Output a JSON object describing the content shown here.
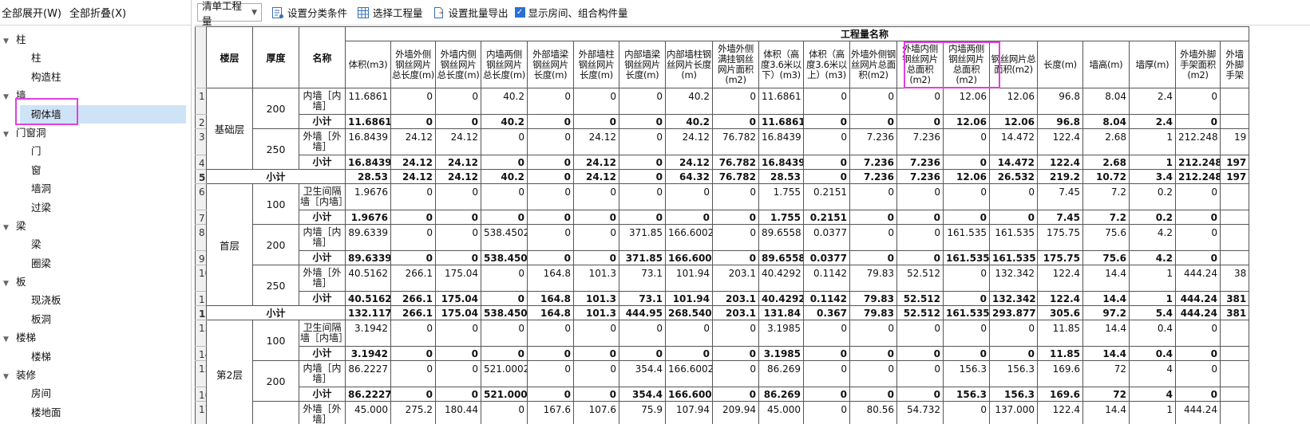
{
  "left_panel": {
    "expand_all": "全部展开(W)",
    "collapse_all": "全部折叠(X)",
    "tree": [
      {
        "label": "柱",
        "type": "cat"
      },
      {
        "label": "柱",
        "type": "leaf"
      },
      {
        "label": "构造柱",
        "type": "leaf"
      },
      {
        "label": "墙",
        "type": "cat"
      },
      {
        "label": "砌体墙",
        "type": "leaf",
        "selected": true
      },
      {
        "label": "门窗洞",
        "type": "cat"
      },
      {
        "label": "门",
        "type": "leaf"
      },
      {
        "label": "窗",
        "type": "leaf"
      },
      {
        "label": "墙洞",
        "type": "leaf"
      },
      {
        "label": "过梁",
        "type": "leaf"
      },
      {
        "label": "梁",
        "type": "cat"
      },
      {
        "label": "梁",
        "type": "leaf"
      },
      {
        "label": "圈梁",
        "type": "leaf"
      },
      {
        "label": "板",
        "type": "cat"
      },
      {
        "label": "现浇板",
        "type": "leaf"
      },
      {
        "label": "板洞",
        "type": "leaf"
      },
      {
        "label": "楼梯",
        "type": "cat"
      },
      {
        "label": "楼梯",
        "type": "leaf"
      },
      {
        "label": "装修",
        "type": "cat"
      },
      {
        "label": "房间",
        "type": "leaf"
      },
      {
        "label": "楼地面",
        "type": "leaf"
      }
    ]
  },
  "toolbar": {
    "qty_type": "清单工程量",
    "set_category": "设置分类条件",
    "select_qty": "选择工程量",
    "set_batch_export": "设置批量导出",
    "show_room": "显示房间、组合构件量",
    "show_room_checked": true
  },
  "table": {
    "group_header": "工程量名称",
    "col_floor": "楼层",
    "col_thickness": "厚度",
    "col_name": "名称",
    "qty_columns": [
      "体积(m3)",
      "外墙外侧钢丝网片总长度(m)",
      "外墙内侧钢丝网片总长度(m)",
      "内墙两侧钢丝网片总长度(m)",
      "外部墙梁钢丝网片长度(m)",
      "外部墙柱钢丝网片长度(m)",
      "内部墙梁钢丝网片长度(m)",
      "内部墙柱钢丝网片长度(m)",
      "外墙外侧满挂钢丝网片面积(m2)",
      "体积（高度3.6米以下）(m3)",
      "体积（高度3.6米以上）(m3)",
      "外墙外侧钢丝网片总面积(m2)",
      "外墙内侧钢丝网片总面积(m2)",
      "内墙两侧钢丝网片总面积(m2)",
      "钢丝网片总面积(m2)",
      "长度(m)",
      "墙高(m)",
      "墙厚(m)",
      "外墙外脚手架面积(m2)",
      "外墙外脚手架"
    ],
    "rows": [
      {
        "n": "1",
        "kind": "item",
        "name": "内墙［内墙］",
        "v": [
          "11.6861",
          "0",
          "0",
          "40.2",
          "0",
          "0",
          "0",
          "40.2",
          "0",
          "11.6861",
          "0",
          "0",
          "0",
          "12.06",
          "12.06",
          "96.8",
          "8.04",
          "2.4",
          "0",
          ""
        ]
      },
      {
        "n": "2",
        "kind": "sub",
        "name": "小计",
        "v": [
          "11.6861",
          "0",
          "0",
          "40.2",
          "0",
          "0",
          "0",
          "40.2",
          "0",
          "11.6861",
          "0",
          "0",
          "0",
          "12.06",
          "12.06",
          "96.8",
          "8.04",
          "2.4",
          "0",
          ""
        ]
      },
      {
        "n": "3",
        "kind": "item",
        "name": "外墙［外墙］",
        "v": [
          "16.8439",
          "24.12",
          "24.12",
          "0",
          "0",
          "24.12",
          "0",
          "24.12",
          "76.782",
          "16.8439",
          "0",
          "7.236",
          "7.236",
          "0",
          "14.472",
          "122.4",
          "2.68",
          "1",
          "212.248",
          "19"
        ]
      },
      {
        "n": "4",
        "kind": "sub",
        "name": "小计",
        "v": [
          "16.8439",
          "24.12",
          "24.12",
          "0",
          "0",
          "24.12",
          "0",
          "24.12",
          "76.782",
          "16.8439",
          "0",
          "7.236",
          "7.236",
          "0",
          "14.472",
          "122.4",
          "2.68",
          "1",
          "212.248",
          "197"
        ]
      },
      {
        "n": "5",
        "kind": "tot",
        "name": "小计",
        "v": [
          "28.53",
          "24.12",
          "24.12",
          "40.2",
          "0",
          "24.12",
          "0",
          "64.32",
          "76.782",
          "28.53",
          "0",
          "7.236",
          "7.236",
          "12.06",
          "26.532",
          "219.2",
          "10.72",
          "3.4",
          "212.248",
          "197"
        ]
      },
      {
        "n": "6",
        "kind": "item",
        "name": "卫生间隔墙［内墙］",
        "v": [
          "1.9676",
          "0",
          "0",
          "0",
          "0",
          "0",
          "0",
          "0",
          "0",
          "1.755",
          "0.2151",
          "0",
          "0",
          "0",
          "0",
          "7.45",
          "7.2",
          "0.2",
          "0",
          ""
        ]
      },
      {
        "n": "7",
        "kind": "sub",
        "name": "小计",
        "v": [
          "1.9676",
          "0",
          "0",
          "0",
          "0",
          "0",
          "0",
          "0",
          "0",
          "1.755",
          "0.2151",
          "0",
          "0",
          "0",
          "0",
          "7.45",
          "7.2",
          "0.2",
          "0",
          ""
        ]
      },
      {
        "n": "8",
        "kind": "item",
        "name": "内墙［内墙］",
        "v": [
          "89.6339",
          "0",
          "0",
          "538.4502",
          "0",
          "0",
          "371.85",
          "166.6002",
          "0",
          "89.6558",
          "0.0377",
          "0",
          "0",
          "161.535",
          "161.535",
          "175.75",
          "75.6",
          "4.2",
          "0",
          ""
        ]
      },
      {
        "n": "9",
        "kind": "sub",
        "name": "小计",
        "v": [
          "89.6339",
          "0",
          "0",
          "538.4502",
          "0",
          "0",
          "371.85",
          "166.6002",
          "0",
          "89.6558",
          "0.0377",
          "0",
          "0",
          "161.535",
          "161.535",
          "175.75",
          "75.6",
          "4.2",
          "0",
          ""
        ]
      },
      {
        "n": "10",
        "kind": "item",
        "name": "外墙［外墙］",
        "v": [
          "40.5162",
          "266.1",
          "175.04",
          "0",
          "164.8",
          "101.3",
          "73.1",
          "101.94",
          "203.1",
          "40.4292",
          "0.1142",
          "79.83",
          "52.512",
          "0",
          "132.342",
          "122.4",
          "14.4",
          "1",
          "444.24",
          "38"
        ]
      },
      {
        "n": "11",
        "kind": "sub",
        "name": "小计",
        "v": [
          "40.5162",
          "266.1",
          "175.04",
          "0",
          "164.8",
          "101.3",
          "73.1",
          "101.94",
          "203.1",
          "40.4292",
          "0.1142",
          "79.83",
          "52.512",
          "0",
          "132.342",
          "122.4",
          "14.4",
          "1",
          "444.24",
          "381"
        ]
      },
      {
        "n": "12",
        "kind": "tot",
        "name": "小计",
        "v": [
          "132.1177",
          "266.1",
          "175.04",
          "538.4502",
          "164.8",
          "101.3",
          "444.95",
          "268.5402",
          "203.1",
          "131.84",
          "0.367",
          "79.83",
          "52.512",
          "161.535",
          "293.877",
          "305.6",
          "97.2",
          "5.4",
          "444.24",
          "381"
        ]
      },
      {
        "n": "13",
        "kind": "item",
        "name": "卫生间隔墙［内墙］",
        "v": [
          "3.1942",
          "0",
          "0",
          "0",
          "0",
          "0",
          "0",
          "0",
          "0",
          "3.1985",
          "0",
          "0",
          "0",
          "0",
          "0",
          "11.85",
          "14.4",
          "0.4",
          "0",
          ""
        ]
      },
      {
        "n": "14",
        "kind": "sub",
        "name": "小计",
        "v": [
          "3.1942",
          "0",
          "0",
          "0",
          "0",
          "0",
          "0",
          "0",
          "0",
          "3.1985",
          "0",
          "0",
          "0",
          "0",
          "0",
          "11.85",
          "14.4",
          "0.4",
          "0",
          ""
        ]
      },
      {
        "n": "15",
        "kind": "item",
        "name": "内墙［内墙］",
        "v": [
          "86.2227",
          "0",
          "0",
          "521.0002",
          "0",
          "0",
          "354.4",
          "166.6002",
          "0",
          "86.269",
          "0",
          "0",
          "0",
          "156.3",
          "156.3",
          "169.6",
          "72",
          "4",
          "0",
          ""
        ]
      },
      {
        "n": "16",
        "kind": "sub",
        "name": "小计",
        "v": [
          "86.2227",
          "0",
          "0",
          "521.0002",
          "0",
          "0",
          "354.4",
          "166.6002",
          "0",
          "86.269",
          "0",
          "0",
          "0",
          "156.3",
          "156.3",
          "169.6",
          "72",
          "4",
          "0",
          ""
        ]
      },
      {
        "n": "17",
        "kind": "item",
        "name": "外墙［外墙］",
        "v": [
          "45.000",
          "275.2",
          "180.44",
          "0",
          "167.6",
          "107.6",
          "75.9",
          "107.94",
          "209.94",
          "45.000",
          "0",
          "80.56",
          "54.732",
          "0",
          "137.000",
          "122.4",
          "14.4",
          "1",
          "444.24",
          ""
        ]
      }
    ],
    "groups": [
      {
        "floor": "基础层",
        "rows": [
          "1",
          "2",
          "3",
          "4"
        ],
        "thick": [
          {
            "t": "200",
            "rows": [
              "1",
              "2"
            ]
          },
          {
            "t": "250",
            "rows": [
              "3",
              "4"
            ]
          }
        ]
      },
      {
        "floor": "首层",
        "rows": [
          "6",
          "7",
          "8",
          "9",
          "10",
          "11"
        ],
        "thick": [
          {
            "t": "100",
            "rows": [
              "6",
              "7"
            ]
          },
          {
            "t": "200",
            "rows": [
              "8",
              "9"
            ]
          },
          {
            "t": "250",
            "rows": [
              "10",
              "11"
            ]
          }
        ]
      },
      {
        "floor": "第2层",
        "rows": [
          "13",
          "14",
          "15",
          "16",
          "17"
        ],
        "thick": [
          {
            "t": "100",
            "rows": [
              "13",
              "14"
            ]
          },
          {
            "t": "200",
            "rows": [
              "15",
              "16"
            ]
          },
          {
            "t": "",
            "rows": [
              "17"
            ]
          }
        ]
      }
    ]
  },
  "colors": {
    "highlight": "#e040e0",
    "selected_bg": "#cfe3f7",
    "accent": "#2b6fd6"
  }
}
